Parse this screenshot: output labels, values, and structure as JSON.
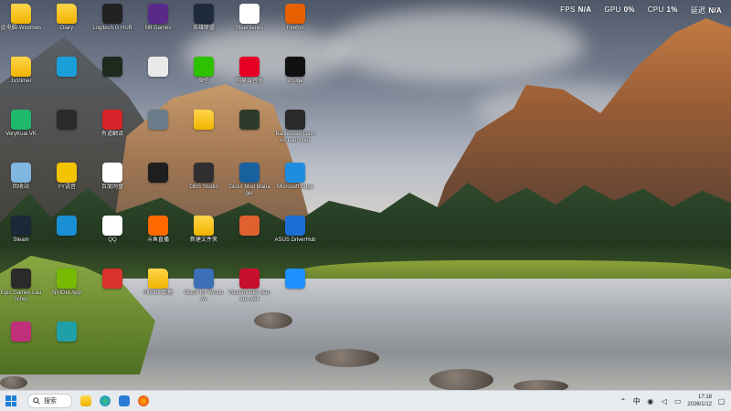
{
  "stats": {
    "fps_label": "FPS",
    "fps_value": "N/A",
    "gpu_label": "GPU",
    "gpu_value": "0%",
    "cpu_label": "CPU",
    "cpu_value": "1%",
    "latency_label": "延迟",
    "latency_value": "N/A"
  },
  "desktop_icons": [
    {
      "label": "此电脑·Windows",
      "icon": "folder-icon",
      "color": "#f0b400"
    },
    {
      "label": "Diary",
      "icon": "folder-icon",
      "color": "#f0b400"
    },
    {
      "label": "Logitech G HUB",
      "icon": "logitech-g-icon",
      "color": "#222222"
    },
    {
      "label": "N8 Games",
      "icon": "game-icon",
      "color": "#5a2a8a"
    },
    {
      "label": "英雄联盟",
      "icon": "game-icon",
      "color": "#1f2b3a"
    },
    {
      "label": "SteelSeries",
      "icon": "steelseries-icon",
      "color": "#ffffff"
    },
    {
      "label": "Firefox",
      "icon": "firefox-icon",
      "color": "#e66000"
    },
    {
      "label": "1v1timer",
      "icon": "folder-icon",
      "color": "#f0b400"
    },
    {
      "label": "",
      "icon": "monitor-icon",
      "color": "#1aa0d8"
    },
    {
      "label": "",
      "icon": "green-arrow-icon",
      "color": "#1e2a1e"
    },
    {
      "label": "",
      "icon": "file-icon",
      "color": "#e9e9e9"
    },
    {
      "label": "微信",
      "icon": "wechat-icon",
      "color": "#2dc100"
    },
    {
      "label": "网易云音乐",
      "icon": "netease-music-icon",
      "color": "#e60026"
    },
    {
      "label": "Zhuge",
      "icon": "z-app-icon",
      "color": "#111111"
    },
    {
      "label": "VeryKuai VK",
      "icon": "verykuai-icon",
      "color": "#1fb86c"
    },
    {
      "label": "",
      "icon": "app-icon",
      "color": "#2b2b2b"
    },
    {
      "label": "有道翻译",
      "icon": "youdao-icon",
      "color": "#d8232a"
    },
    {
      "label": "",
      "icon": "app-icon",
      "color": "#6a7b8a"
    },
    {
      "label": "",
      "icon": "folder-icon",
      "color": "#f0b400"
    },
    {
      "label": "",
      "icon": "app-icon",
      "color": "#2d3b2a"
    },
    {
      "label": "Battlestate Games Launcher",
      "icon": "battlestate-icon",
      "color": "#2a2a2a"
    },
    {
      "label": "回收站",
      "icon": "recycle-bin-icon",
      "color": "#7fb7e0"
    },
    {
      "label": "YY语音",
      "icon": "yy-icon",
      "color": "#f5c400"
    },
    {
      "label": "百度网盘",
      "icon": "baidu-cloud-icon",
      "color": "#ffffff"
    },
    {
      "label": "",
      "icon": "app-icon",
      "color": "#1e1e1e"
    },
    {
      "label": "OBS Studio",
      "icon": "obs-icon",
      "color": "#302e31"
    },
    {
      "label": "Gloss Mod Manager",
      "icon": "gloss-mod-icon",
      "color": "#18609e"
    },
    {
      "label": "Microsoft Edge",
      "icon": "edge-icon",
      "color": "#1e8de0"
    },
    {
      "label": "Steam",
      "icon": "steam-icon",
      "color": "#1b2838"
    },
    {
      "label": "",
      "icon": "app-icon",
      "color": "#1a8fd6"
    },
    {
      "label": "QQ",
      "icon": "qq-icon",
      "color": "#ffffff"
    },
    {
      "label": "斗鱼直播",
      "icon": "douyu-icon",
      "color": "#ff6a00"
    },
    {
      "label": "新建文件夹",
      "icon": "folder-icon",
      "color": "#f0b400"
    },
    {
      "label": "",
      "icon": "app-icon",
      "color": "#e06030"
    },
    {
      "label": "ASUS DriverHub",
      "icon": "asus-icon",
      "color": "#1d6fd6"
    },
    {
      "label": "Epic Games Launcher",
      "icon": "epic-icon",
      "color": "#2a2a2a"
    },
    {
      "label": "NVIDIA App",
      "icon": "nvidia-icon",
      "color": "#76b900"
    },
    {
      "label": "",
      "icon": "app-icon",
      "color": "#d8322a"
    },
    {
      "label": "Firefox 数据",
      "icon": "folder-icon",
      "color": "#f0b400"
    },
    {
      "label": "Clash for Windows",
      "icon": "clash-icon",
      "color": "#3b6fb8"
    },
    {
      "label": "Voicemeeter Banana x64",
      "icon": "voicemeeter-icon",
      "color": "#c8102e"
    },
    {
      "label": "",
      "icon": "app-icon",
      "color": "#1e90ff"
    },
    {
      "label": "",
      "icon": "app-icon",
      "color": "#c0307a"
    },
    {
      "label": "",
      "icon": "app-icon",
      "color": "#1fa0a8"
    }
  ],
  "taskbar": {
    "search_label": "搜索",
    "time": "17:18",
    "date": "2026/1/12"
  }
}
